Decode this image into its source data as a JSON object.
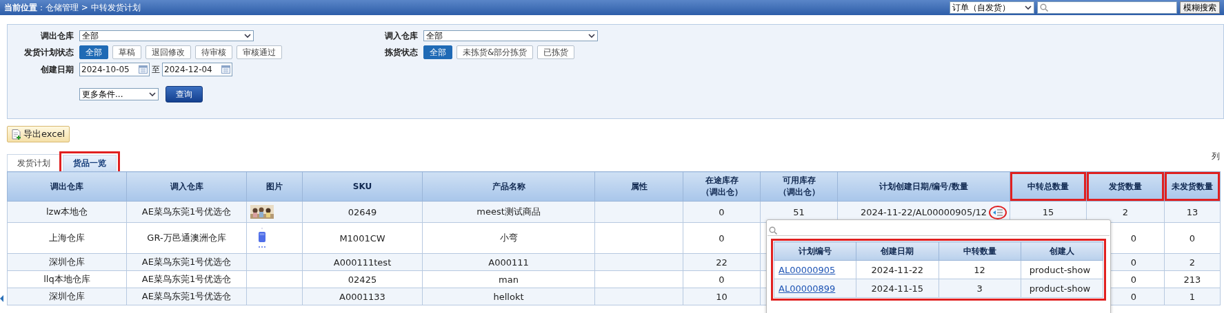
{
  "header": {
    "breadcrumb": "**当前位置**：仓储管理 > 中转发货计划",
    "search_type": "订单（自发货）",
    "search_button": "模糊搜索"
  },
  "filters": {
    "from_warehouse": {
      "label": "调出仓库",
      "value": "全部"
    },
    "to_warehouse": {
      "label": "调入仓库",
      "value": "全部"
    },
    "plan_status": {
      "label": "发货计划状态",
      "options": [
        {
          "label": "全部",
          "selected": true
        },
        {
          "label": "草稿",
          "selected": false
        },
        {
          "label": "退回修改",
          "selected": false
        },
        {
          "label": "待审核",
          "selected": false
        },
        {
          "label": "审核通过",
          "selected": false
        }
      ]
    },
    "pick_status": {
      "label": "拣货状态",
      "options": [
        {
          "label": "全部",
          "selected": true
        },
        {
          "label": "未拣货&部分拣货",
          "selected": false
        },
        {
          "label": "已拣货",
          "selected": false
        }
      ]
    },
    "created": {
      "label": "创建日期",
      "from": "2024-10-05",
      "separator": "至",
      "to": "2024-12-04"
    },
    "more": "更多条件...",
    "query_button": "查询"
  },
  "export_button": "导出excel",
  "tabs": [
    {
      "label": "发货计划",
      "selected": false,
      "highlighted": false
    },
    {
      "label": "货品一览",
      "selected": true,
      "highlighted": true
    }
  ],
  "columns_link": "列",
  "table": {
    "columns": [
      {
        "label": "调出仓库",
        "highlighted": false
      },
      {
        "label": "调入仓库",
        "highlighted": false
      },
      {
        "label": "图片",
        "highlighted": false
      },
      {
        "label": "SKU",
        "highlighted": false
      },
      {
        "label": "产品名称",
        "highlighted": false
      },
      {
        "label": "属性",
        "highlighted": false
      },
      {
        "label": "在途库存",
        "sublabel": "（调出仓）",
        "highlighted": false
      },
      {
        "label": "可用库存",
        "sublabel": "（调出仓）",
        "highlighted": false
      },
      {
        "label": "计划创建日期/编号/数量",
        "highlighted": false
      },
      {
        "label": "中转总数量",
        "highlighted": true
      },
      {
        "label": "发货数量",
        "highlighted": true
      },
      {
        "label": "未发货数量",
        "highlighted": true
      }
    ],
    "rows": [
      {
        "cells": [
          "lzw本地仓",
          "AE菜鸟东莞1号优选仓",
          {
            "kind": "picture"
          },
          "02649",
          "meest测试商品",
          "",
          "0",
          "51",
          "2024-11-22/AL00000905/12",
          "15",
          "2",
          "13"
        ],
        "expander": {
          "highlighted": true
        }
      },
      {
        "cells": [
          "上海仓库",
          "GR-万邑通澳洲仓库",
          {
            "kind": "picture"
          },
          "M1001CW",
          "小弯",
          "",
          "0",
          "",
          "",
          "",
          "0",
          "0"
        ]
      },
      {
        "cells": [
          "深圳仓库",
          "AE菜鸟东莞1号优选仓",
          "",
          "A000111test",
          "A000111",
          "",
          "22",
          "",
          "",
          "",
          "0",
          "2"
        ]
      },
      {
        "cells": [
          "llq本地仓库",
          "AE菜鸟东莞1号优选仓",
          "",
          "02425",
          "man",
          "",
          "0",
          "",
          "",
          "",
          "0",
          "213"
        ]
      },
      {
        "cells": [
          "深圳仓库",
          "AE菜鸟东莞1号优选仓",
          "",
          "A0001133",
          "hellokt",
          "",
          "10",
          "",
          "",
          "",
          "0",
          "1"
        ]
      }
    ]
  },
  "popup": {
    "highlighted": true,
    "columns": [
      "计划编号",
      "创建日期",
      "中转数量",
      "创建人"
    ],
    "rows": [
      [
        "AL00000905",
        "2024-11-22",
        "12",
        "product-show"
      ],
      [
        "AL00000899",
        "2024-11-15",
        "3",
        "product-show"
      ]
    ]
  }
}
